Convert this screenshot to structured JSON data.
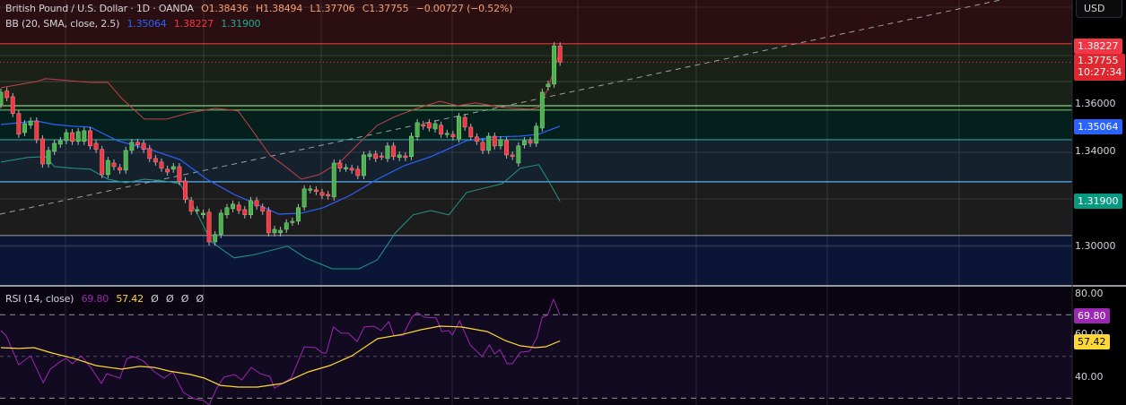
{
  "header": {
    "symbol": "British Pound / U.S. Dollar · 1D · OANDA",
    "open": "O1.38436",
    "high": "H1.38494",
    "low": "L1.37706",
    "close": "C1.37755",
    "change": "−0.00727 (−0.52%)"
  },
  "bb_legend": {
    "label": "BB (20, SMA, close, 2.5)",
    "basis": "1.35064",
    "upper": "1.38227",
    "lower": "1.31900"
  },
  "rsi_legend": {
    "label": "RSI (14, close)",
    "rsi": "69.80",
    "ma": "57.42",
    "na": [
      "Ø",
      "Ø",
      "Ø",
      "Ø"
    ]
  },
  "price_axis": {
    "currency": "USD",
    "ticks": [
      "1.36000",
      "1.34000",
      "1.30000"
    ],
    "tag_upper": "1.38227",
    "tag_price": "1.37755",
    "countdown": "10:27:34",
    "tag_basis": "1.35064",
    "tag_lower": "1.31900"
  },
  "rsi_axis": {
    "ticks": [
      "80.00",
      "60.00",
      "40.00"
    ],
    "tag_rsi": "69.80",
    "tag_ma": "57.42"
  },
  "colors": {
    "up": "#4caf50",
    "down": "#f23645",
    "basis": "#2962ff",
    "upper": "#c2404a",
    "lower": "#22998a",
    "rsi": "#9c27b0",
    "rsi_ma": "#fdd835"
  },
  "chart_data": {
    "type": "candlestick",
    "price_range": [
      1.2838,
      1.4037
    ],
    "candles": [
      [
        1.3597,
        1.3649
      ],
      [
        1.3654,
        1.3626
      ],
      [
        1.363,
        1.3559
      ],
      [
        1.3559,
        1.3472
      ],
      [
        1.3479,
        1.3517
      ],
      [
        1.351,
        1.3528
      ],
      [
        1.3528,
        1.3449
      ],
      [
        1.3453,
        1.3347
      ],
      [
        1.3347,
        1.3404
      ],
      [
        1.34,
        1.3434
      ],
      [
        1.343,
        1.3445
      ],
      [
        1.3445,
        1.3479
      ],
      [
        1.3479,
        1.3442
      ],
      [
        1.3442,
        1.3483
      ],
      [
        1.3442,
        1.3487
      ],
      [
        1.3487,
        1.3423
      ],
      [
        1.3434,
        1.3408
      ],
      [
        1.3408,
        1.3302
      ],
      [
        1.3302,
        1.3362
      ],
      [
        1.3351,
        1.3336
      ],
      [
        1.3332,
        1.3321
      ],
      [
        1.3321,
        1.3404
      ],
      [
        1.3404,
        1.3438
      ],
      [
        1.3438,
        1.3427
      ],
      [
        1.3434,
        1.3408
      ],
      [
        1.3412,
        1.337
      ],
      [
        1.337,
        1.3355
      ],
      [
        1.3355,
        1.3329
      ],
      [
        1.3325,
        1.3313
      ],
      [
        1.3325,
        1.3336
      ],
      [
        1.3336,
        1.3272
      ],
      [
        1.3276,
        1.3197
      ],
      [
        1.3193,
        1.3148
      ],
      [
        1.3151,
        1.3155
      ],
      [
        1.3133,
        1.314
      ],
      [
        1.3144,
        1.3019
      ],
      [
        1.3019,
        1.305
      ],
      [
        1.305,
        1.314
      ],
      [
        1.3133,
        1.3163
      ],
      [
        1.3159,
        1.3178
      ],
      [
        1.3174,
        1.3151
      ],
      [
        1.3155,
        1.3133
      ],
      [
        1.3133,
        1.3193
      ],
      [
        1.3193,
        1.317
      ],
      [
        1.3166,
        1.3148
      ],
      [
        1.3151,
        1.3057
      ],
      [
        1.3057,
        1.3072
      ],
      [
        1.3057,
        1.3068
      ],
      [
        1.3072,
        1.3099
      ],
      [
        1.3102,
        1.3106
      ],
      [
        1.3106,
        1.3163
      ],
      [
        1.3166,
        1.3242
      ],
      [
        1.3238,
        1.3242
      ],
      [
        1.3238,
        1.3231
      ],
      [
        1.3227,
        1.3215
      ],
      [
        1.3219,
        1.3212
      ],
      [
        1.3208,
        1.3351
      ],
      [
        1.3351,
        1.3329
      ],
      [
        1.3329,
        1.3332
      ],
      [
        1.3329,
        1.3321
      ],
      [
        1.3325,
        1.3298
      ],
      [
        1.3298,
        1.3385
      ],
      [
        1.3378,
        1.3389
      ],
      [
        1.3389,
        1.337
      ],
      [
        1.3381,
        1.3378
      ],
      [
        1.337,
        1.3423
      ],
      [
        1.3423,
        1.3378
      ],
      [
        1.3374,
        1.3385
      ],
      [
        1.3381,
        1.3374
      ],
      [
        1.3378,
        1.3464
      ],
      [
        1.3461,
        1.3521
      ],
      [
        1.3513,
        1.3506
      ],
      [
        1.3521,
        1.3498
      ],
      [
        1.3494,
        1.3517
      ],
      [
        1.351,
        1.3472
      ],
      [
        1.3472,
        1.3476
      ],
      [
        1.3472,
        1.3461
      ],
      [
        1.3453,
        1.3547
      ],
      [
        1.3543,
        1.3502
      ],
      [
        1.3502,
        1.3461
      ],
      [
        1.3461,
        1.3442
      ],
      [
        1.3438,
        1.3404
      ],
      [
        1.3404,
        1.3464
      ],
      [
        1.3464,
        1.3423
      ],
      [
        1.3423,
        1.3449
      ],
      [
        1.3445,
        1.3385
      ],
      [
        1.3385,
        1.3378
      ],
      [
        1.3351,
        1.3423
      ],
      [
        1.3427,
        1.3445
      ],
      [
        1.3445,
        1.3434
      ],
      [
        1.3434,
        1.3506
      ],
      [
        1.3498,
        1.3649
      ],
      [
        1.3672,
        1.3683
      ],
      [
        1.3683,
        1.3844
      ],
      [
        1.38436,
        1.37755
      ]
    ],
    "bb_basis": [
      [
        0,
        1.3513
      ],
      [
        6,
        1.3528
      ],
      [
        9,
        1.3513
      ],
      [
        12,
        1.3506
      ],
      [
        15,
        1.3502
      ],
      [
        19.6,
        1.3445
      ],
      [
        25.6,
        1.3404
      ],
      [
        30.1,
        1.3366
      ],
      [
        34.6,
        1.3283
      ],
      [
        39.2,
        1.3219
      ],
      [
        43.7,
        1.317
      ],
      [
        46.7,
        1.3136
      ],
      [
        50.5,
        1.314
      ],
      [
        54.2,
        1.3163
      ],
      [
        58.7,
        1.3215
      ],
      [
        63.3,
        1.3283
      ],
      [
        67.8,
        1.334
      ],
      [
        72.3,
        1.3378
      ],
      [
        78.3,
        1.3445
      ],
      [
        82.8,
        1.3461
      ],
      [
        87.3,
        1.3464
      ],
      [
        90.4,
        1.3472
      ],
      [
        94,
        1.35064
      ]
    ],
    "bb_upper": [
      [
        0,
        1.3668
      ],
      [
        6,
        1.3694
      ],
      [
        7.5,
        1.3706
      ],
      [
        15,
        1.369
      ],
      [
        18,
        1.369
      ],
      [
        20.3,
        1.3623
      ],
      [
        24.1,
        1.3536
      ],
      [
        27.9,
        1.3536
      ],
      [
        31.6,
        1.3562
      ],
      [
        36.1,
        1.3581
      ],
      [
        39.9,
        1.357
      ],
      [
        42.2,
        1.3491
      ],
      [
        45.2,
        1.3385
      ],
      [
        48.2,
        1.3329
      ],
      [
        50.5,
        1.3283
      ],
      [
        53.5,
        1.3302
      ],
      [
        57.2,
        1.3359
      ],
      [
        60.2,
        1.3434
      ],
      [
        63.3,
        1.351
      ],
      [
        66.3,
        1.3547
      ],
      [
        70,
        1.3581
      ],
      [
        73.8,
        1.3611
      ],
      [
        76.8,
        1.3592
      ],
      [
        79.8,
        1.3604
      ],
      [
        84.3,
        1.3585
      ],
      [
        88.9,
        1.3577
      ],
      [
        90.4,
        1.3585
      ],
      [
        91.9,
        1.366
      ],
      [
        94,
        1.38227
      ]
    ],
    "bb_lower": [
      [
        0,
        1.3355
      ],
      [
        4.5,
        1.3374
      ],
      [
        7.5,
        1.3378
      ],
      [
        9,
        1.3336
      ],
      [
        12,
        1.3329
      ],
      [
        15,
        1.3325
      ],
      [
        18,
        1.3283
      ],
      [
        21,
        1.3268
      ],
      [
        24.1,
        1.3283
      ],
      [
        27.1,
        1.3276
      ],
      [
        30.1,
        1.3264
      ],
      [
        33.1,
        1.3133
      ],
      [
        35.4,
        1.3019
      ],
      [
        39.2,
        1.2952
      ],
      [
        42.2,
        1.2963
      ],
      [
        45.2,
        1.2982
      ],
      [
        48.2,
        1.3001
      ],
      [
        51.2,
        1.2952
      ],
      [
        55.7,
        1.2906
      ],
      [
        60.2,
        1.2906
      ],
      [
        63.3,
        1.2944
      ],
      [
        66.3,
        1.3057
      ],
      [
        69.3,
        1.3133
      ],
      [
        72.3,
        1.3151
      ],
      [
        75.3,
        1.3133
      ],
      [
        78.3,
        1.3227
      ],
      [
        81.3,
        1.3246
      ],
      [
        84.3,
        1.3264
      ],
      [
        87.3,
        1.3329
      ],
      [
        90.4,
        1.3344
      ],
      [
        91.9,
        1.3283
      ],
      [
        94,
        1.319
      ]
    ],
    "levels": [
      {
        "price": 1.3853,
        "color": "#e53935"
      },
      {
        "price": 1.3694,
        "color": "#3a3f3a"
      },
      {
        "price": 1.3592,
        "color": "#8bc98b"
      },
      {
        "price": 1.3574,
        "color": "#6fb56f"
      },
      {
        "price": 1.3449,
        "color": "#2aa198"
      },
      {
        "price": 1.3396,
        "color": "#2f3640"
      },
      {
        "price": 1.3272,
        "color": "#5ab0f0"
      },
      {
        "price": 1.3046,
        "color": "#8a8f98"
      },
      {
        "price": 1.3004,
        "color": "#26304a"
      }
    ],
    "current_price": 1.37755,
    "trendline": [
      [
        0,
        1.3136
      ],
      [
        1115,
        1.4037
      ]
    ],
    "rsi_range": [
      26.7,
      83.4
    ],
    "rsi_bands": [
      70,
      50,
      30
    ],
    "rsi": [
      [
        0,
        62.4
      ],
      [
        0.9,
        59.8
      ],
      [
        3,
        46
      ],
      [
        5,
        50.3
      ],
      [
        7.1,
        37.4
      ],
      [
        8.3,
        43.9
      ],
      [
        10.1,
        47.7
      ],
      [
        11,
        49
      ],
      [
        12,
        46.5
      ],
      [
        13.5,
        50.3
      ],
      [
        15.1,
        44.7
      ],
      [
        16.9,
        37
      ],
      [
        17.8,
        41.7
      ],
      [
        20,
        39.6
      ],
      [
        21.2,
        49
      ],
      [
        22.4,
        49.9
      ],
      [
        24,
        47.7
      ],
      [
        25.8,
        42.6
      ],
      [
        27.4,
        39.6
      ],
      [
        28.9,
        42.6
      ],
      [
        30.7,
        32.7
      ],
      [
        32.5,
        29.7
      ],
      [
        34.1,
        28.8
      ],
      [
        35,
        26.7
      ],
      [
        36.3,
        34.8
      ],
      [
        37.5,
        40
      ],
      [
        39.3,
        41.3
      ],
      [
        40.5,
        38.7
      ],
      [
        42.1,
        44.7
      ],
      [
        43.6,
        41.7
      ],
      [
        45.2,
        40.4
      ],
      [
        46,
        34.8
      ],
      [
        47.3,
        37
      ],
      [
        48.8,
        39.6
      ],
      [
        51,
        54.6
      ],
      [
        52.9,
        54.2
      ],
      [
        54.1,
        51.6
      ],
      [
        54.7,
        51.6
      ],
      [
        55.9,
        64.1
      ],
      [
        57.2,
        61.1
      ],
      [
        58.4,
        61.1
      ],
      [
        59.9,
        57.2
      ],
      [
        61.1,
        64.1
      ],
      [
        62.7,
        64.5
      ],
      [
        63.9,
        62.4
      ],
      [
        65.2,
        66.7
      ],
      [
        66.1,
        59.8
      ],
      [
        67.6,
        60.2
      ],
      [
        69.1,
        68.8
      ],
      [
        70,
        71
      ],
      [
        71.2,
        68.8
      ],
      [
        73.2,
        68.4
      ],
      [
        74.1,
        61.9
      ],
      [
        75.3,
        62.4
      ],
      [
        75.9,
        60.2
      ],
      [
        77.1,
        67.1
      ],
      [
        78.9,
        55.5
      ],
      [
        80.9,
        49.9
      ],
      [
        82.1,
        55.5
      ],
      [
        83,
        51.2
      ],
      [
        83.9,
        53.3
      ],
      [
        85.1,
        46.5
      ],
      [
        86,
        46.5
      ],
      [
        87.3,
        52
      ],
      [
        88.9,
        52.5
      ],
      [
        90.1,
        58.9
      ],
      [
        91,
        68.8
      ],
      [
        91.9,
        69.7
      ],
      [
        92.9,
        77.4
      ],
      [
        94,
        69.8
      ]
    ],
    "rsi_ma": [
      [
        0,
        54.2
      ],
      [
        3,
        53.8
      ],
      [
        5.6,
        54.2
      ],
      [
        8.6,
        51.6
      ],
      [
        12.3,
        49
      ],
      [
        16,
        45.6
      ],
      [
        20.3,
        43.9
      ],
      [
        23.3,
        45.2
      ],
      [
        25.8,
        44.7
      ],
      [
        28.3,
        43
      ],
      [
        31.9,
        41.3
      ],
      [
        34.2,
        39.6
      ],
      [
        36.9,
        36.1
      ],
      [
        39.9,
        35.3
      ],
      [
        43.1,
        35.3
      ],
      [
        47.3,
        37
      ],
      [
        51.7,
        42.6
      ],
      [
        55.3,
        45.6
      ],
      [
        59,
        50.3
      ],
      [
        63.3,
        58.5
      ],
      [
        67.6,
        60.6
      ],
      [
        70.6,
        62.8
      ],
      [
        73.8,
        64.5
      ],
      [
        77.4,
        64.1
      ],
      [
        81.8,
        61.9
      ],
      [
        84.8,
        57.6
      ],
      [
        87.3,
        55.1
      ],
      [
        89.8,
        54.2
      ],
      [
        91.6,
        54.6
      ],
      [
        94,
        57.42
      ]
    ]
  }
}
